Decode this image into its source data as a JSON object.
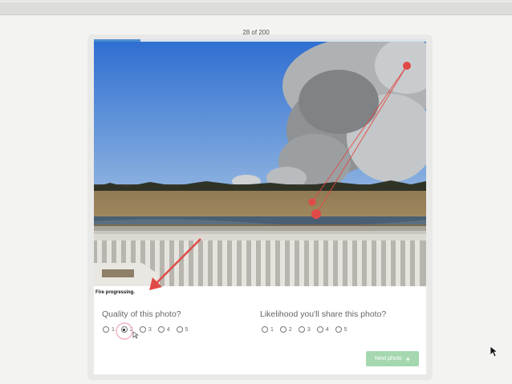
{
  "counter": "28 of 200",
  "progress_fraction": 0.14,
  "photo": {
    "caption": "Fire progressing."
  },
  "quality_question": {
    "title": "Quality of this photo?",
    "options": [
      "1",
      "2",
      "3",
      "4",
      "5"
    ],
    "selected": "2"
  },
  "share_question": {
    "title": "Likelihood you'll share this photo?",
    "options": [
      "1",
      "2",
      "3",
      "4",
      "5"
    ],
    "selected": null
  },
  "next_button": {
    "label": "Next photo",
    "icon": "plus-icon"
  },
  "colors": {
    "accent": "#4a8ed1",
    "next_button": "#a6d8b0",
    "annotation": "#e04a46"
  }
}
